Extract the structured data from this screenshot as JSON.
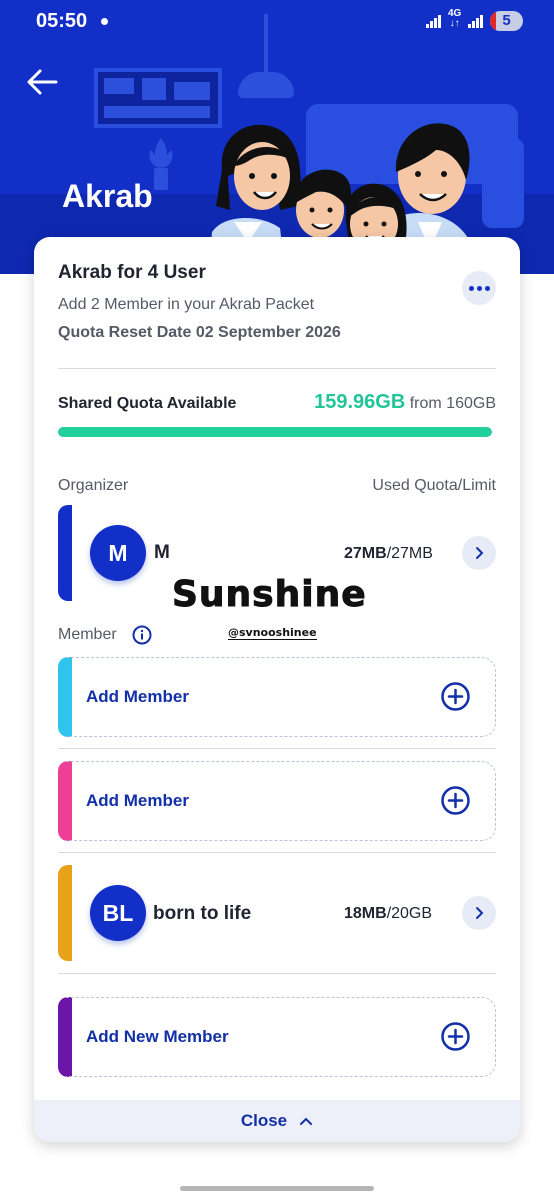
{
  "status_bar": {
    "time": "05:50",
    "network": "4G",
    "battery": "5"
  },
  "header": {
    "title": "Akrab",
    "back_icon": "arrow-left-icon",
    "background_color": "#1230c8"
  },
  "package": {
    "title": "Akrab for 4 User",
    "subtitle": "Add 2 Member in your Akrab Packet",
    "reset_date": "Quota Reset Date 02 September 2026",
    "more_icon": "more-horizontal-icon"
  },
  "shared_quota": {
    "label": "Shared Quota Available",
    "value": "159.96GB",
    "from": "from 160GB",
    "fill_fraction": 0.99975,
    "bar_color": "#22d09e"
  },
  "organizer_section": {
    "label": "Organizer",
    "used_label": "Used Quota/Limit",
    "organizer": {
      "initials": "M",
      "name": "M",
      "used": "27MB",
      "limit": "/27MB",
      "accent": "#1230c8"
    }
  },
  "member_section": {
    "label": "Member",
    "info_icon": "info-icon",
    "slots": [
      {
        "type": "add",
        "label": "Add Member",
        "accent": "#2ec4ec"
      },
      {
        "type": "add",
        "label": "Add Member",
        "accent": "#ec3f95"
      },
      {
        "type": "member",
        "initials": "BL",
        "name": "born to life",
        "used": "18MB",
        "limit": "/20GB",
        "accent": "#e8a21a"
      },
      {
        "type": "add",
        "label": "Add New Member",
        "accent": "#6b16a8"
      }
    ]
  },
  "sticker": {
    "title": "Sunshine",
    "handle": "@svnooshinee"
  },
  "footer": {
    "close_label": "Close",
    "chevron_icon": "chevron-up-icon"
  }
}
